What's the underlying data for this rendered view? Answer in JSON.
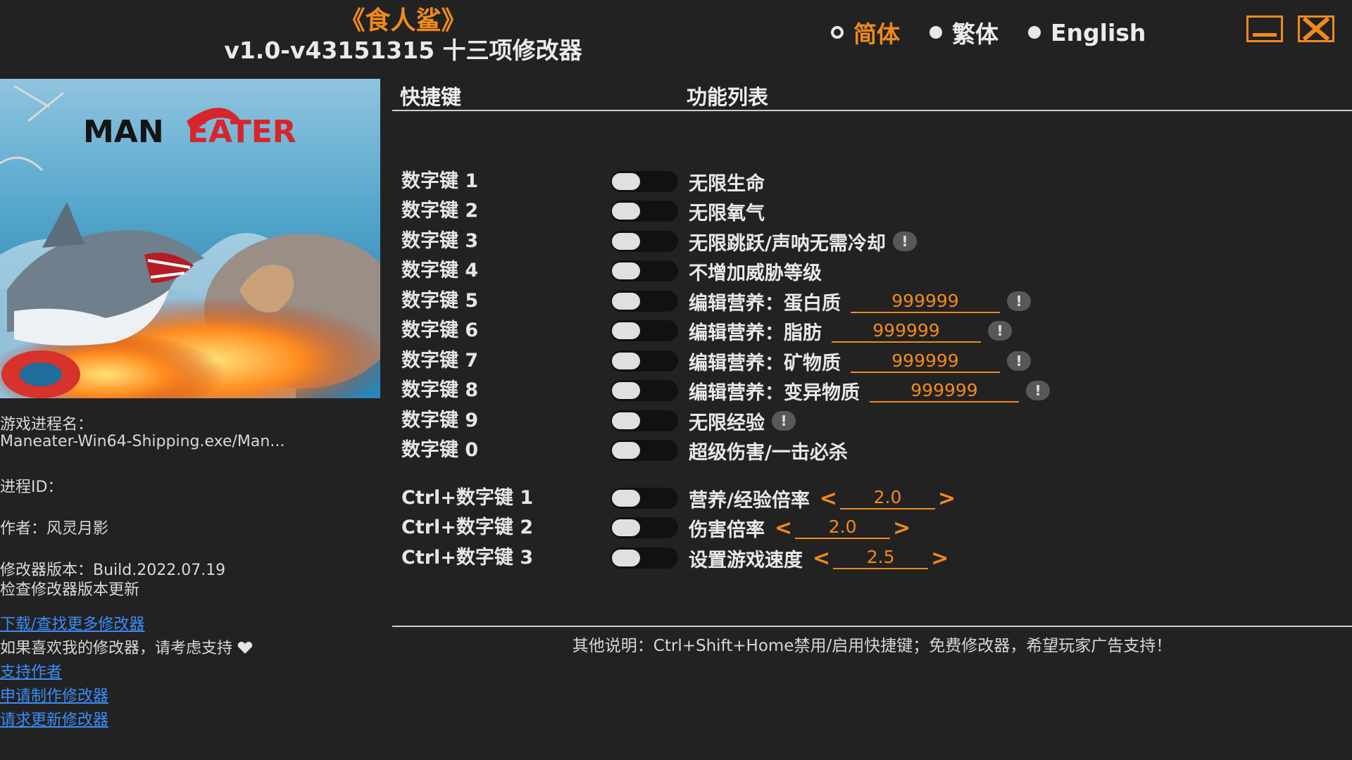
{
  "title": {
    "game": "《食人鲨》",
    "version": "v1.0-v43151315 十三项修改器"
  },
  "languages": [
    {
      "label": "简体",
      "selected": true
    },
    {
      "label": "繁体",
      "selected": false
    },
    {
      "label": "English",
      "selected": false
    }
  ],
  "cover": {
    "logo_text_1": "MAN",
    "logo_text_2": "EATER"
  },
  "info": {
    "process_label": "游戏进程名：",
    "process_value": "Maneater-Win64-Shipping.exe/Man...",
    "pid_label": "进程ID：",
    "author": "作者：风灵月影",
    "build": "修改器版本：Build.2022.07.19",
    "check_update": "检查修改器版本更新",
    "links": {
      "download": "下载/查找更多修改器",
      "support_prompt": "如果喜欢我的修改器，请考虑支持",
      "support_author": "支持作者",
      "request_make": "申请制作修改器",
      "request_update": "请求更新修改器"
    }
  },
  "headers": {
    "hotkey": "快捷键",
    "functions": "功能列表"
  },
  "options": [
    {
      "hotkey": "数字键 1",
      "label": "无限生命"
    },
    {
      "hotkey": "数字键 2",
      "label": "无限氧气"
    },
    {
      "hotkey": "数字键 3",
      "label": "无限跳跃/声呐无需冷却"
    },
    {
      "hotkey": "数字键 4",
      "label": "不增加威胁等级"
    },
    {
      "hotkey": "数字键 5",
      "label": "编辑营养：蛋白质",
      "value": "999999"
    },
    {
      "hotkey": "数字键 6",
      "label": "编辑营养：脂肪",
      "value": "999999"
    },
    {
      "hotkey": "数字键 7",
      "label": "编辑营养：矿物质",
      "value": "999999"
    },
    {
      "hotkey": "数字键 8",
      "label": "编辑营养：变异物质",
      "value": "999999"
    },
    {
      "hotkey": "数字键 9",
      "label": "无限经验"
    },
    {
      "hotkey": "数字键 0",
      "label": "超级伤害/一击必杀"
    },
    {
      "hotkey": "Ctrl+数字键 1",
      "label": "营养/经验倍率",
      "value": "2.0"
    },
    {
      "hotkey": "Ctrl+数字键 2",
      "label": "伤害倍率",
      "value": "2.0"
    },
    {
      "hotkey": "Ctrl+数字键 3",
      "label": "设置游戏速度",
      "value": "2.5"
    }
  ],
  "symbols": {
    "warn": "!",
    "arrow_left": "<",
    "arrow_right": ">"
  },
  "footer": "其他说明：Ctrl+Shift+Home禁用/启用快捷键；免费修改器，希望玩家广告支持！",
  "colors": {
    "accent": "#f08a1c",
    "background": "#222223",
    "link": "#3a8df5"
  },
  "icons": {
    "minimize": "minimize-icon",
    "close": "close-icon",
    "warning": "warning-icon",
    "heart": "heart-icon"
  }
}
